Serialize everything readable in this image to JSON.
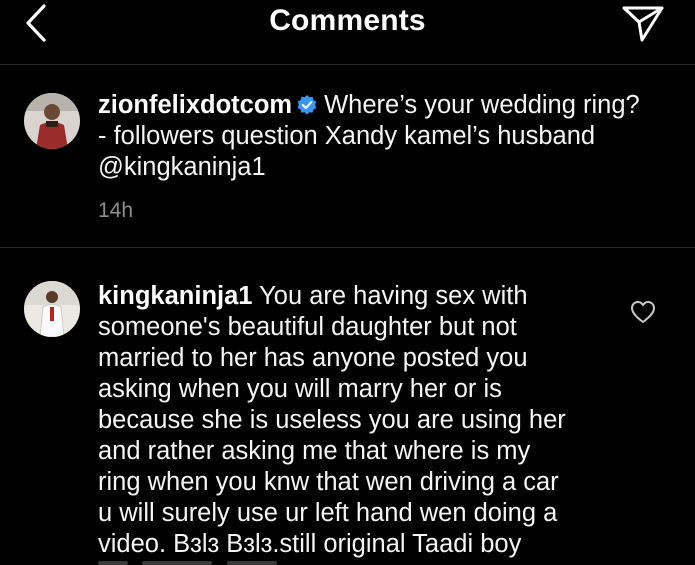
{
  "header": {
    "title": "Comments",
    "back_icon": "chevron-left-icon",
    "send_icon": "paper-plane-icon"
  },
  "caption": {
    "username": "zionfelixdotcom",
    "verified_color": "#3897f0",
    "text_line1": "Where’s your wedding ring?",
    "text_line2": "- followers question Xandy kamel’s husband",
    "text_line3": "@kingkaninja1",
    "time": "14h"
  },
  "comment": {
    "username": "kingkaninja1",
    "line1": "You are having sex with",
    "line2": "someone's beautiful daughter but not",
    "line3": "married to her has anyone posted you",
    "line4": "asking when you will marry her or is",
    "line5": "because she is useless you are using her",
    "line6": "and rather asking me that where is my",
    "line7": "ring when you knw that wen driving a car",
    "line8": "u will surely use ur left hand wen doing a",
    "line9": "video. Bɜlɜ Bɜlɜ.still original Taadi boy",
    "like_icon": "heart-outline-icon"
  },
  "colors": {
    "background": "#000000",
    "text": "#f5f5f5",
    "muted": "#8e8e8e",
    "divider": "#262626"
  }
}
